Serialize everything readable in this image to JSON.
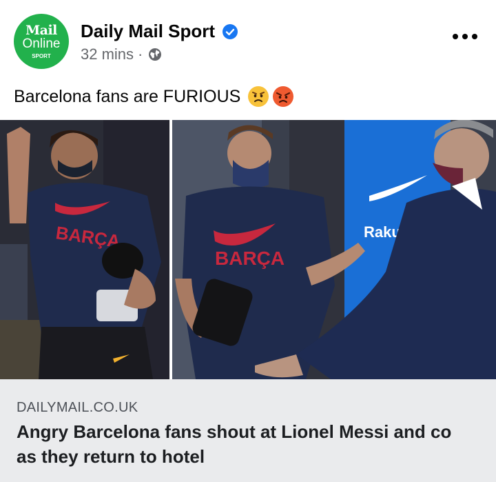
{
  "post": {
    "avatar": {
      "line1": "Mail",
      "line2": "Online",
      "line3": "SPORT"
    },
    "page_name": "Daily Mail Sport",
    "timestamp": "32 mins",
    "separator": "·",
    "text": "Barcelona fans are FURIOUS",
    "emojis": [
      "worried-face-emoji",
      "angry-face-emoji"
    ],
    "icons": {
      "verified": "verified-badge-icon",
      "audience": "globe-icon",
      "more": "more-options-icon"
    }
  },
  "photo": {
    "shirt_text": "BARÇA",
    "sponsor_text": "Rakuten",
    "colors": {
      "shirt": "#1f2b4d",
      "accent": "#c8283e",
      "panel": "#1a6fd6"
    }
  },
  "link_preview": {
    "domain": "DAILYMAIL.CO.UK",
    "headline_line1": "Angry Barcelona fans shout at Lionel Messi and co",
    "headline_line2": "as they return to hotel"
  },
  "colors": {
    "brand_green": "#22b14c",
    "verified_blue": "#1877f2",
    "meta_gray": "#65676b",
    "link_bg": "#eaebed"
  }
}
